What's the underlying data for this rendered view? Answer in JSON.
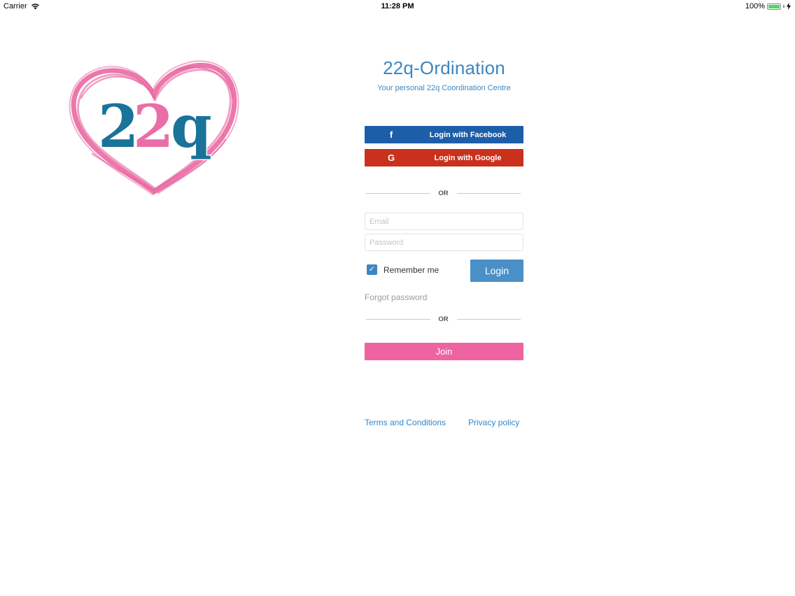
{
  "status_bar": {
    "carrier": "Carrier",
    "time": "11:28 PM",
    "battery": "100%",
    "battery_level": 1.0
  },
  "logo": {
    "text": "22q",
    "heart_color": "#e8609c",
    "blue": "#1a7399",
    "pink": "#ea6ea6"
  },
  "app": {
    "title": "22q-Ordination",
    "subtitle": "Your personal 22q Coordination Centre"
  },
  "social": {
    "facebook_icon": "f",
    "facebook_label": "Login with Facebook",
    "google_icon": "G",
    "google_label": "Login with Google"
  },
  "divider_text": "OR",
  "form": {
    "email_placeholder": "Email",
    "password_placeholder": "Password",
    "remember_label": "Remember me",
    "remember_checked": true,
    "login_label": "Login",
    "forgot_label": "Forgot password"
  },
  "join_label": "Join",
  "footer": {
    "terms": "Terms and Conditions",
    "privacy": "Privacy policy"
  },
  "colors": {
    "accent": "#3d86c1",
    "facebook": "#1d5ea9",
    "google": "#c9311d",
    "join": "#ee64a0"
  }
}
